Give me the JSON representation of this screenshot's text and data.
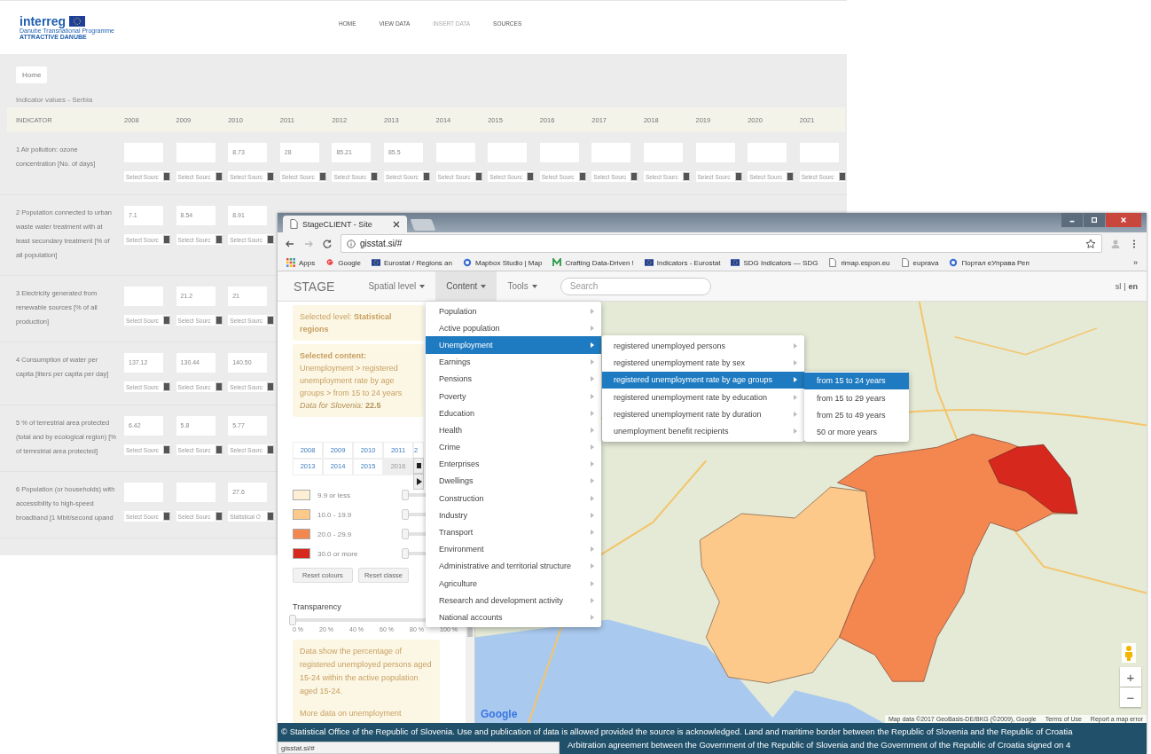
{
  "back_window": {
    "logo": {
      "name": "interreg",
      "programme": "Danube Transnational Programme",
      "project": "ATTRACTIVE DANUBE"
    },
    "nav": [
      {
        "label": "HOME",
        "selected": false
      },
      {
        "label": "VIEW DATA",
        "selected": false
      },
      {
        "label": "INSERT DATA",
        "selected": true
      },
      {
        "label": "SOURCES",
        "selected": false
      }
    ],
    "breadcrumb": "Home",
    "title": "Indicator values - Serbia",
    "indicator_header": "INDICATOR",
    "years": [
      "2008",
      "2009",
      "2010",
      "2011",
      "2012",
      "2013",
      "2014",
      "2015",
      "2016",
      "2017",
      "2018",
      "2019",
      "2020",
      "2021"
    ],
    "rows": [
      {
        "indicator": "1 Air pollution: ozone concentration [No. of days]",
        "cells": [
          {
            "source": "Select Sourc"
          },
          {
            "source": "Select Sourc"
          },
          {
            "value": "8.73",
            "source": "Select Sourc"
          },
          {
            "value": "28",
            "source": "Select Sourc"
          },
          {
            "value": "85.21",
            "source": "Select Sourc"
          },
          {
            "value": "85.5",
            "source": "Select Sourc"
          },
          {
            "source": "Select Sourc"
          },
          {
            "source": "Select Sourc"
          },
          {
            "source": "Select Sourc"
          },
          {
            "source": "Select Sourc"
          },
          {
            "source": "Select Sourc"
          },
          {
            "source": "Select Sourc"
          },
          {
            "source": "Select Sourc"
          },
          {
            "source": "Select Sourc"
          }
        ]
      },
      {
        "indicator": "2 Population connected to urban waste water treatment with at least secondary treatment [% of all population]",
        "cells": [
          {
            "value": "7.1",
            "source": "Select Sourc"
          },
          {
            "value": "8.54",
            "source": "Select Sourc"
          },
          {
            "value": "8.91",
            "source": "Select Sourc"
          }
        ]
      },
      {
        "indicator": "3 Electricity generated from renewable sources [% of all production]",
        "cells": [
          {
            "source": "Select Sourc"
          },
          {
            "value": "21.2",
            "source": "Select Sourc"
          },
          {
            "value": "21",
            "source": "Select Sourc"
          }
        ]
      },
      {
        "indicator": "4 Consumption of water per capita [liters per capita per day]",
        "cells": [
          {
            "value": "137.12",
            "source": "Select Sourc"
          },
          {
            "value": "130.44",
            "source": "Select Sourc"
          },
          {
            "value": "140.50",
            "source": "Select Sourc"
          }
        ]
      },
      {
        "indicator": "5 % of terrestrial area protected (total and by ecological region) [% of terrestrial area protected]",
        "cells": [
          {
            "value": "6.42",
            "source": "Select Sourc"
          },
          {
            "value": "5.8",
            "source": "Select Sourc"
          },
          {
            "value": "5.77",
            "source": "Select Sourc"
          }
        ]
      },
      {
        "indicator": "6 Population (or households) with accessibility to high-speed broadband [1 Mbit/second upand",
        "cells": [
          {
            "source": "Select Sourc"
          },
          {
            "source": "Select Sourc"
          },
          {
            "value": "27.6",
            "source": "Statistical O"
          }
        ]
      }
    ]
  },
  "front_window": {
    "browser": {
      "tab": "StageCLIENT - Site",
      "url": "gisstat.si/#",
      "status": "gisstat.si/#",
      "bookmarks": [
        {
          "kind": "apps",
          "label": "Apps"
        },
        {
          "kind": "google",
          "label": "Google"
        },
        {
          "kind": "flag",
          "label": "Eurostat / Regions an"
        },
        {
          "kind": "globe",
          "label": "Mapbox Studio | Map"
        },
        {
          "kind": "leaf",
          "label": "Crafting Data-Driven !"
        },
        {
          "kind": "flag",
          "label": "Indicators - Eurostat"
        },
        {
          "kind": "flag",
          "label": "SDG Indicators — SDG"
        },
        {
          "kind": "page",
          "label": "rimap.espon.eu"
        },
        {
          "kind": "page",
          "label": "euprava"
        },
        {
          "kind": "globe",
          "label": "Портал еУправа Реп"
        }
      ],
      "more": "»"
    },
    "app": {
      "brand": "STAGE",
      "menus": [
        {
          "label": "Spatial level",
          "selected": false
        },
        {
          "label": "Content",
          "selected": true
        },
        {
          "label": "Tools",
          "selected": false
        }
      ],
      "search": {
        "placeholder": "Search"
      },
      "languages": [
        {
          "label": "sl",
          "selected": false
        },
        {
          "label": "en",
          "selected": true
        }
      ],
      "language_separator": "|"
    },
    "sidebar": {
      "level_box": "Selected level: **Statistical regions**",
      "content_box": {
        "heading": "Selected content:",
        "path": "Unemployment > registered unemployment rate by age groups > from 15 to 24 years",
        "data": "*Data for Slovenia:* **22.5**"
      },
      "years": [
        {
          "label": "2008",
          "selected": false
        },
        {
          "label": "2009",
          "selected": false
        },
        {
          "label": "2010",
          "selected": false
        },
        {
          "label": "2011",
          "selected": false
        },
        {
          "label": "2",
          "selected": false
        },
        {
          "label": "2013",
          "selected": false
        },
        {
          "label": "2014",
          "selected": false
        },
        {
          "label": "2015",
          "selected": false
        },
        {
          "label": "2016",
          "selected": true
        }
      ],
      "legend": [
        {
          "label": "9.9 or less",
          "color": "#fdefd6",
          "level": 0
        },
        {
          "label": "10.0 - 19.9",
          "color": "#fdc98a",
          "level": 0
        },
        {
          "label": "20.0 - 29.9",
          "color": "#f4874f",
          "level": 0
        },
        {
          "label": "30.0 or more",
          "color": "#d7281e",
          "level": 0
        }
      ],
      "buttons": [
        "Reset colours",
        "Reset classe"
      ],
      "transparency": {
        "label": "Transparency",
        "level": 0,
        "ticks": [
          "0 %",
          "20 %",
          "40 %",
          "60 %",
          "80 %",
          "100 %"
        ]
      },
      "note": "Data show the percentage of registered unemployed persons aged 15-24 within the active population aged 15-24.",
      "more": "More data on unemployment"
    },
    "menu": [
      {
        "label": "Population",
        "selected": false
      },
      {
        "label": "Active population",
        "selected": false
      },
      {
        "label": "Unemployment",
        "selected": true,
        "children": [
          {
            "label": "registered unemployed persons",
            "selected": false
          },
          {
            "label": "registered unemployment rate by sex",
            "selected": false
          },
          {
            "label": "registered unemployment rate by age groups",
            "selected": true,
            "children": [
              {
                "label": "from 15 to 24 years",
                "selected": true
              },
              {
                "label": "from 15 to 29 years",
                "selected": false
              },
              {
                "label": "from 25 to 49 years",
                "selected": false
              },
              {
                "label": "50 or more years",
                "selected": false
              }
            ]
          },
          {
            "label": "registered unemployment rate by education",
            "selected": false
          },
          {
            "label": "registered unemployment rate by duration",
            "selected": false
          },
          {
            "label": "unemployment benefit recipients",
            "selected": false
          }
        ]
      },
      {
        "label": "Earnings",
        "selected": false
      },
      {
        "label": "Pensions",
        "selected": false
      },
      {
        "label": "Poverty",
        "selected": false
      },
      {
        "label": "Education",
        "selected": false
      },
      {
        "label": "Health",
        "selected": false
      },
      {
        "label": "Crime",
        "selected": false
      },
      {
        "label": "Enterprises",
        "selected": false
      },
      {
        "label": "Dwellings",
        "selected": false
      },
      {
        "label": "Construction",
        "selected": false
      },
      {
        "label": "Industry",
        "selected": false
      },
      {
        "label": "Transport",
        "selected": false
      },
      {
        "label": "Environment",
        "selected": false
      },
      {
        "label": "Administrative and territorial structure",
        "selected": false
      },
      {
        "label": "Agriculture",
        "selected": false
      },
      {
        "label": "Research and development activity",
        "selected": false
      },
      {
        "label": "National accounts",
        "selected": false
      }
    ],
    "map": {
      "logo": "Google",
      "attribution": "Map data ©2017 GeoBasis-DE/BKG (©2009), Google",
      "terms": "Terms of Use",
      "report": "Report a map error",
      "zoom_in": "+",
      "zoom_out": "−"
    },
    "footer": [
      "© Statistical Office of the Republic of Slovenia. Use and publication of data is allowed provided the source is acknowledged. Land and maritime border between the Republic of Slovenia and the Republic of Croatia",
      "Arbitration agreement between the Government of the Republic of Slovenia and the Government of the Republic of Croatia signed on 4"
    ]
  }
}
